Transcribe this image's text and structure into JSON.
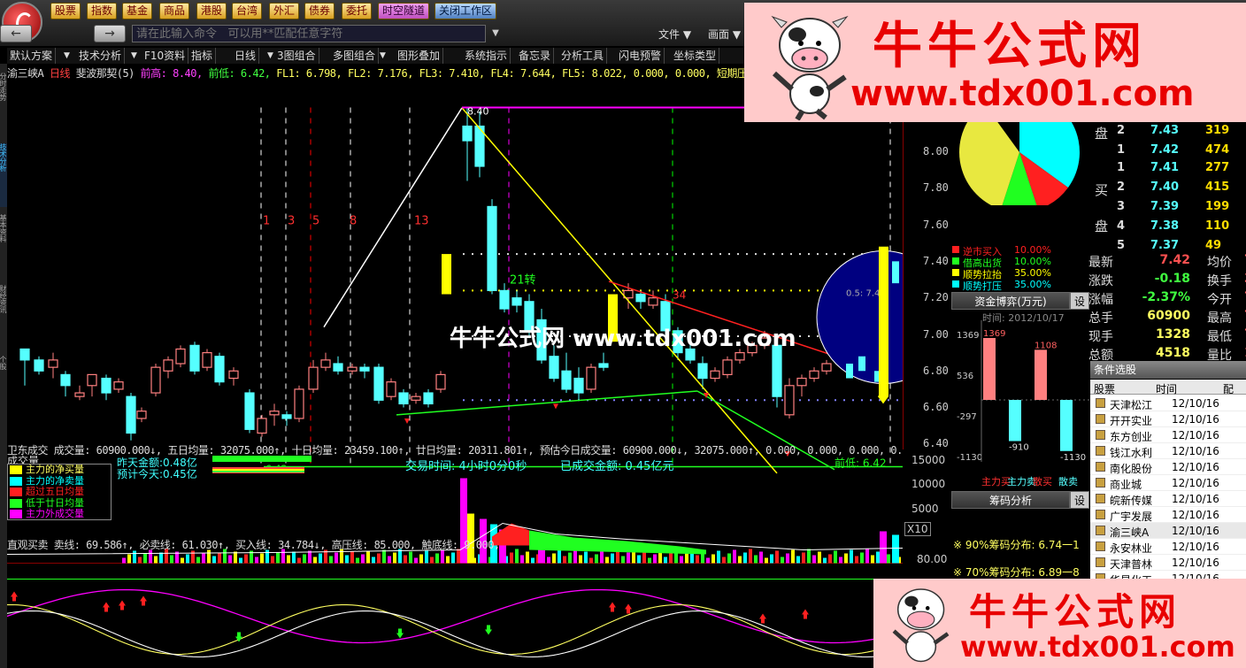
{
  "top_nav": [
    "股票",
    "指数",
    "基金",
    "商品",
    "港股",
    "台湾",
    "外汇",
    "债券",
    "委托",
    "时空隧道",
    "关闭工作区"
  ],
  "command_placeholder": "请在此输入命令   可以用**匹配任意字符",
  "top_menus": [
    "文件",
    "画面"
  ],
  "toolbar": [
    "默认方案",
    "技术分析",
    "F10资料",
    "指标",
    "日线",
    "3图组合",
    "多图组合",
    "图形叠加",
    "系统指示",
    "备忘录",
    "分析工具",
    "闪电预警",
    "坐标类型"
  ],
  "left_tabs": [
    "分时走势",
    "技术分析",
    "基本资料",
    "财经资讯",
    "个股"
  ],
  "chart_info": {
    "name": "渝三峡A",
    "period": "日线",
    "indicator": "斐波那契(5)",
    "high_label": "前高: 8.40,",
    "low_label": "前低: 6.42,",
    "fl": "FL1: 6.798, FL2: 7.176, FL3: 7.410, FL4: 7.644, FL5: 8.022, 0.000, 0.000, 短期压力: 0.000, 短期"
  },
  "chart_labels": {
    "fib_numbers": [
      "1",
      "3",
      "5",
      "8",
      "13"
    ],
    "peak": "8.40",
    "turn": "21转",
    "n34": "34",
    "low_left": "6.42",
    "low_right": "前低: 6.42",
    "fib_inside": "0.5: 7.41"
  },
  "price_axis": [
    "8.00",
    "7.80",
    "7.60",
    "7.40",
    "7.20",
    "7.00",
    "6.80",
    "6.60",
    "6.40"
  ],
  "watermark_center": "牛牛公式网 www.tdx001.com",
  "ad": {
    "title": "牛牛公式网",
    "url": "www.tdx001.com"
  },
  "volume_info": "卫东成交 成交量: 60900.000↓, 五日均量: 32075.000↑, 十日均量: 23459.100↑, 廿日均量: 20311.801↑, 预估今日成交量: 60900.000↓, 32075.000↑, 0.000, 0.000, 0.000, 0.000, 0.000, 0",
  "volume_legend_title": "成交量",
  "volume_legend": [
    {
      "label": "主力的净买量",
      "color": "#ffff00"
    },
    {
      "label": "主力的净卖量",
      "color": "#00ffff"
    },
    {
      "label": "超过五日均量",
      "color": "#ff2020"
    },
    {
      "label": "低于廿日均量",
      "color": "#20ff20"
    },
    {
      "label": "主力外成交量",
      "color": "#ff00ff"
    }
  ],
  "volume_stats": {
    "yesterday_label": "昨天金额:",
    "yesterday": "0.48亿",
    "estimate_label": "预计今天:",
    "estimate": "0.45亿",
    "trade_time": "交易时间: 4小时0分0秒",
    "amount": "已成交金额: 0.45亿元"
  },
  "volume_axis": [
    "15000",
    "10000",
    "5000",
    "X10"
  ],
  "indicator_info": "直观买卖 卖线: 69.586↑, 必卖线: 61.030↑, 买入线: 34.784↓, 高压线: 85.000, 触底线: 9.000,",
  "indicator_axis": [
    "80.00"
  ],
  "indicator_marks": [
    "留意",
    "留意",
    "留意",
    "留意"
  ],
  "order_book": {
    "sell": [
      {
        "lvl": "2",
        "price": "7.43",
        "vol": "319"
      },
      {
        "lvl": "1",
        "price": "7.42",
        "vol": "474"
      }
    ],
    "buy": [
      {
        "lvl": "1",
        "price": "7.41",
        "vol": "277"
      },
      {
        "lvl": "2",
        "price": "7.40",
        "vol": "415"
      },
      {
        "lvl": "3",
        "price": "7.39",
        "vol": "199"
      },
      {
        "lvl": "4",
        "price": "7.38",
        "vol": "110"
      },
      {
        "lvl": "5",
        "price": "7.37",
        "vol": "49"
      }
    ],
    "side_sell": "盘",
    "side_buy_top": "买",
    "side_buy_bottom": "盘"
  },
  "pie_legend": [
    {
      "label": "逆市买入",
      "value": "10.00%",
      "color": "#ff2020"
    },
    {
      "label": "借高出货",
      "value": "10.00%",
      "color": "#20ff20"
    },
    {
      "label": "顺势拉抬",
      "value": "35.00%",
      "color": "#ffff00"
    },
    {
      "label": "顺势打压",
      "value": "35.00%",
      "color": "#00ffff"
    }
  ],
  "quote": [
    {
      "l1": "最新",
      "v1": "7.42",
      "c1": "#ff5050",
      "l2": "均价",
      "v2": "7"
    },
    {
      "l1": "涨跌",
      "v1": "-0.18",
      "c1": "#40ff40",
      "l2": "换手",
      "v2": "3.5"
    },
    {
      "l1": "涨幅",
      "v1": "-2.37%",
      "c1": "#40ff40",
      "l2": "今开",
      "v2": "7"
    },
    {
      "l1": "总手",
      "v1": "60900",
      "c1": "#ffff60",
      "l2": "最高",
      "v2": "7"
    },
    {
      "l1": "现手",
      "v1": "1328",
      "c1": "#ffff60",
      "l2": "最低",
      "v2": "7"
    },
    {
      "l1": "总额",
      "v1": "4518",
      "c1": "#ffff60",
      "l2": "量比",
      "v2": "1"
    }
  ],
  "fund_panel": {
    "title": "资金博弈(万元)",
    "settings": "设",
    "time": "时间: 2012/10/17",
    "axis": [
      "1369",
      "536",
      "-297",
      "-1130"
    ],
    "bars": [
      {
        "label": "主力买",
        "value": "1369"
      },
      {
        "label": "主力卖",
        "value": "-910"
      },
      {
        "label": "散买",
        "value": "1108"
      },
      {
        "label": "散卖",
        "value": "-1130"
      }
    ]
  },
  "chip_panel": {
    "title": "筹码分析",
    "settings": "设",
    "line90": "※ 90%筹码分布: 6.74一1",
    "line70": "※ 70%筹码分布: 6.89一8"
  },
  "stock_list": {
    "title": "条件选股",
    "headers": [
      "股票",
      "时间",
      "配"
    ],
    "rows": [
      {
        "name": "天津松江",
        "date": "12/10/16"
      },
      {
        "name": "开开实业",
        "date": "12/10/16"
      },
      {
        "name": "东方创业",
        "date": "12/10/16"
      },
      {
        "name": "钱江水利",
        "date": "12/10/16"
      },
      {
        "name": "南化股份",
        "date": "12/10/16"
      },
      {
        "name": "商业城",
        "date": "12/10/16"
      },
      {
        "name": "皖新传媒",
        "date": "12/10/16"
      },
      {
        "name": "广宇发展",
        "date": "12/10/16"
      },
      {
        "name": "渝三峡A",
        "date": "12/10/16"
      },
      {
        "name": "永安林业",
        "date": "12/10/16"
      },
      {
        "name": "天津普林",
        "date": "12/10/16"
      },
      {
        "name": "华星化工",
        "date": "12/10/16"
      }
    ]
  }
}
